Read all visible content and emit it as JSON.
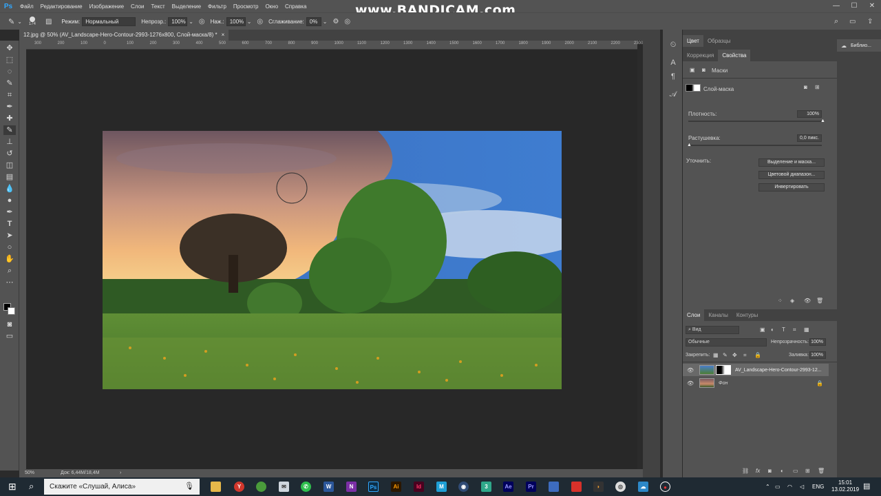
{
  "watermark": "www.BANDICAM.com",
  "menu": {
    "app_logo": "Ps",
    "items": [
      "Файл",
      "Редактирование",
      "Изображение",
      "Слои",
      "Текст",
      "Выделение",
      "Фильтр",
      "Просмотр",
      "Окно",
      "Справка"
    ]
  },
  "options": {
    "brush_size": "174",
    "mode_label": "Режим:",
    "mode_value": "Нормальный",
    "opacity_label": "Непрозр.:",
    "opacity_value": "100%",
    "pressure_label": "Наж.:",
    "pressure_value": "100%",
    "smoothing_label": "Сглаживание:",
    "smoothing_value": "0%"
  },
  "document": {
    "tab_title": "12.jpg @ 50% (AV_Landscape-Hero-Contour-2993-1276x800, Слой-маска/8) *",
    "close": "×"
  },
  "ruler": {
    "ticks": [
      "300",
      "200",
      "100",
      "0",
      "100",
      "200",
      "300",
      "400",
      "500",
      "600",
      "700",
      "800",
      "900",
      "1000",
      "1100",
      "1200",
      "1300",
      "1400",
      "1500",
      "1600",
      "1700",
      "1800",
      "1900",
      "2000",
      "2100",
      "2200",
      "2300"
    ]
  },
  "status": {
    "zoom": "50%",
    "doc": "Док: 6,44M/18,4M"
  },
  "panels": {
    "top_tabs": [
      "Цвет",
      "Образцы"
    ],
    "prop_tabs": [
      "Коррекция",
      "Свойства"
    ],
    "masks_label": "Маски",
    "layer_mask_label": "Слой-маска",
    "density_label": "Плотность:",
    "density_value": "100%",
    "density_fraction": 1.0,
    "feather_label": "Растушевка:",
    "feather_value": "0,0 пикс.",
    "feather_fraction": 0.0,
    "refine_label": "Уточнить:",
    "buttons": [
      "Выделение и маска...",
      "Цветовой диапазон...",
      "Инвертировать"
    ],
    "library_label": "Библио..."
  },
  "layers": {
    "tabs": [
      "Слои",
      "Каналы",
      "Контуры"
    ],
    "filter_value": "Вид",
    "blend_mode": "Обычные",
    "opacity_label": "Непрозрачность:",
    "opacity_value": "100%",
    "lock_label": "Закрепить:",
    "fill_label": "Заливка:",
    "fill_value": "100%",
    "items": [
      {
        "name": "AV_Landscape-Hero-Contour-2993-12...",
        "selected": true
      },
      {
        "name": "Фон",
        "selected": false
      }
    ]
  },
  "taskbar": {
    "search_placeholder": "Скажите «Слушай, Алиса»",
    "lang": "ENG",
    "time": "15:01",
    "date": "13.02.2019"
  },
  "colors": {
    "panel": "#535353",
    "dark": "#424242",
    "canvas": "#282828",
    "accent": "#31a8ff"
  }
}
